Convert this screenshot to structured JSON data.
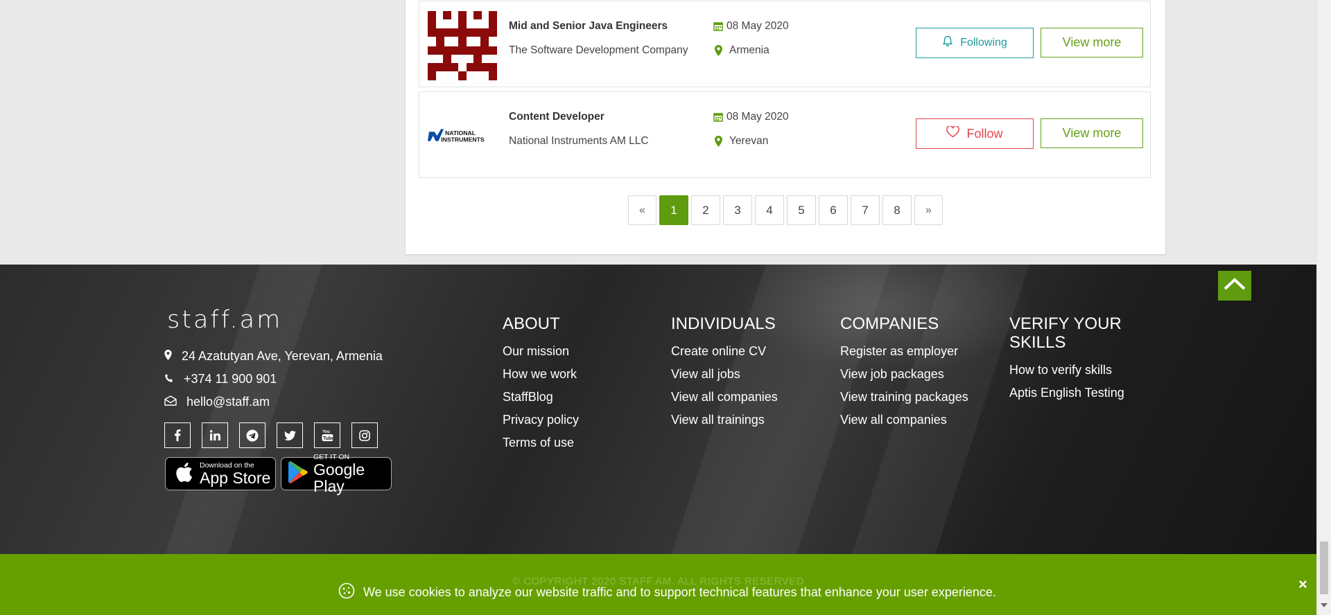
{
  "jobs": [
    {
      "title": "Mid and Senior Java Engineers",
      "company": "The Software Development Company",
      "date": "08 May 2020",
      "location": "Armenia",
      "follow_label": "Following",
      "view_label": "View more",
      "logo": "red-pattern-logo"
    },
    {
      "title": "Content Developer",
      "company": "National Instruments AM LLC",
      "date": "08 May 2020",
      "location": "Yerevan",
      "follow_label": "Follow",
      "view_label": "View more",
      "logo_text": "NATIONAL INSTRUMENTS"
    }
  ],
  "pagination": {
    "prev": "«",
    "pages": [
      "1",
      "2",
      "3",
      "4",
      "5",
      "6",
      "7",
      "8"
    ],
    "next": "»",
    "active": "1"
  },
  "footer": {
    "logo": "staff.am",
    "address": "24 Azatutyan Ave, Yerevan, Armenia",
    "phone": "+374 11 900 901",
    "email": "hello@staff.am",
    "socials": [
      "facebook-icon",
      "linkedin-icon",
      "telegram-icon",
      "twitter-icon",
      "youtube-icon",
      "instagram-icon"
    ],
    "app_store": {
      "small": "Download on the",
      "big": "App Store"
    },
    "google_play": {
      "small": "GET IT ON",
      "big": "Google Play"
    },
    "columns": [
      {
        "title": "ABOUT",
        "links": [
          "Our mission",
          "How we work",
          "StaffBlog",
          "Privacy policy",
          "Terms of use"
        ]
      },
      {
        "title": "INDIVIDUALS",
        "links": [
          "Create online CV",
          "View all jobs",
          "View all companies",
          "View all trainings"
        ]
      },
      {
        "title": "COMPANIES",
        "links": [
          "Register as employer",
          "View job packages",
          "View training packages",
          "View all companies"
        ]
      },
      {
        "title": "VERIFY YOUR SKILLS",
        "links": [
          "How to verify skills",
          "Aptis English Testing"
        ]
      }
    ]
  },
  "cookie": {
    "copyright": "© COPYRIGHT 2020 STAFF.AM. ALL RIGHTS RESERVED",
    "text": "We use cookies to analyze our website traffic and to support technical features that enhance your user experience.",
    "close": "×"
  },
  "colors": {
    "accent": "#5f9b0e",
    "following": "#1b9a98",
    "follow": "#e2454a",
    "cookie_bar": "#66a000"
  }
}
